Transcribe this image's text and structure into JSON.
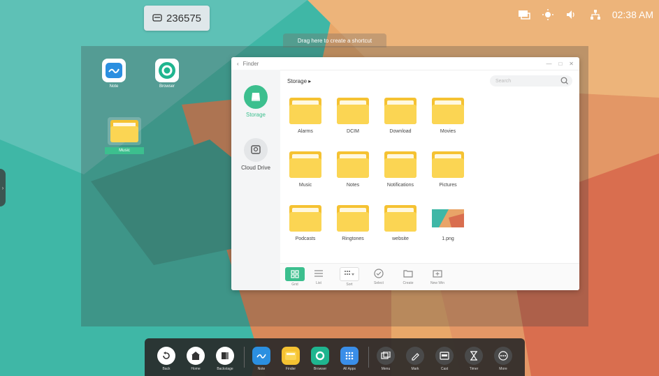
{
  "pin": {
    "code": "236575"
  },
  "status": {
    "time": "02:38 AM",
    "icons": [
      "screen-share-icon",
      "brightness-icon",
      "volume-icon",
      "network-icon"
    ]
  },
  "drag_hint": "Drag here to create a shortcut",
  "desktop": {
    "icons": [
      {
        "label": "Note",
        "icon": "note-icon"
      },
      {
        "label": "Browser",
        "icon": "browser-icon"
      },
      {
        "label": "Music",
        "icon": "folder-icon"
      }
    ]
  },
  "finder": {
    "title": "Finder",
    "sidebar": [
      {
        "label": "Storage",
        "icon": "storage-icon",
        "active": true
      },
      {
        "label": "Cloud Drive",
        "icon": "cloud-drive-icon",
        "active": false
      }
    ],
    "path": "Storage",
    "search_placeholder": "Search",
    "items": [
      {
        "name": "Alarms",
        "type": "folder"
      },
      {
        "name": "DCIM",
        "type": "folder"
      },
      {
        "name": "Download",
        "type": "folder"
      },
      {
        "name": "Movies",
        "type": "folder"
      },
      {
        "name": "Music",
        "type": "folder"
      },
      {
        "name": "Notes",
        "type": "folder"
      },
      {
        "name": "Notifications",
        "type": "folder"
      },
      {
        "name": "Pictures",
        "type": "folder"
      },
      {
        "name": "Podcasts",
        "type": "folder"
      },
      {
        "name": "Ringtones",
        "type": "folder"
      },
      {
        "name": "website",
        "type": "folder"
      },
      {
        "name": "1.png",
        "type": "image"
      }
    ],
    "toolbar": [
      {
        "label": "Grid",
        "icon": "grid-icon",
        "active": true
      },
      {
        "label": "List",
        "icon": "list-icon"
      },
      {
        "label": "Sort",
        "icon": "sort-icon"
      },
      {
        "label": "Select",
        "icon": "select-icon"
      },
      {
        "label": "Create",
        "icon": "create-folder-icon"
      },
      {
        "label": "New Win",
        "icon": "new-window-icon"
      }
    ]
  },
  "dock": {
    "items": [
      {
        "label": "Back",
        "icon": "back-icon"
      },
      {
        "label": "Home",
        "icon": "home-icon"
      },
      {
        "label": "Backstage",
        "icon": "backstage-icon"
      },
      {
        "label": "Note",
        "icon": "note-icon"
      },
      {
        "label": "Finder",
        "icon": "finder-icon"
      },
      {
        "label": "Browser",
        "icon": "browser-icon"
      },
      {
        "label": "All Apps",
        "icon": "all-apps-icon"
      },
      {
        "label": "Menu",
        "icon": "menu-icon"
      },
      {
        "label": "Mark",
        "icon": "pen-icon"
      },
      {
        "label": "Cast",
        "icon": "cast-icon"
      },
      {
        "label": "Timer",
        "icon": "timer-icon"
      },
      {
        "label": "More",
        "icon": "more-icon"
      }
    ]
  },
  "colors": {
    "accent": "#3cbf8e",
    "folder": "#f5c232",
    "teal_bg": "#3fb7a6",
    "orange_bg": "#e9a468"
  }
}
